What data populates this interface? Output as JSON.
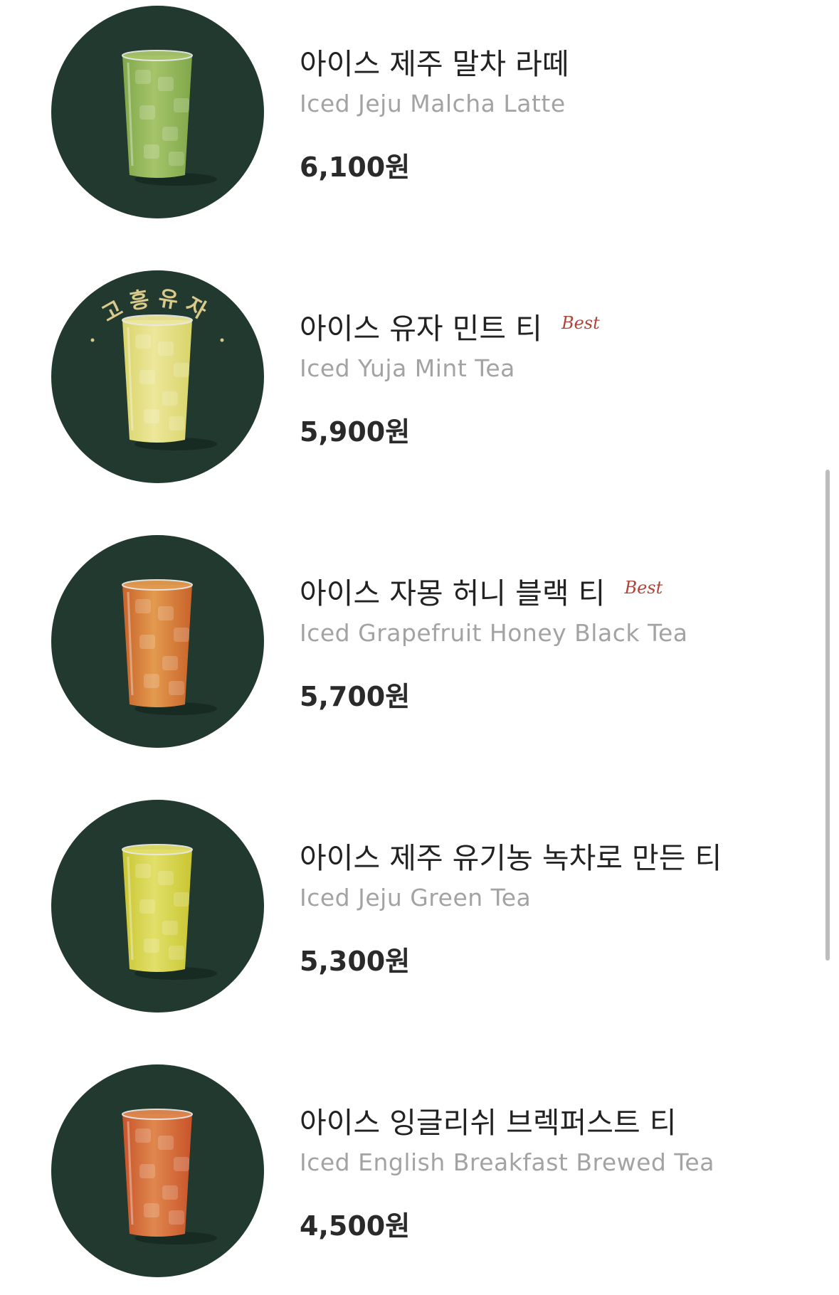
{
  "items": [
    {
      "name_ko": "아이스 제주 말차 라떼",
      "name_en": "Iced Jeju Malcha Latte",
      "price": "6,100원",
      "best": "",
      "drink_color": "#7fa84a",
      "drink_color_light": "#a6c46a",
      "ribbon_text": ""
    },
    {
      "name_ko": "아이스 유자 민트 티",
      "name_en": "Iced Yuja Mint Tea",
      "price": "5,900원",
      "best": "Best",
      "drink_color": "#d9d46a",
      "drink_color_light": "#ece79a",
      "ribbon_text": "고흥유자"
    },
    {
      "name_ko": "아이스 자몽 허니 블랙 티",
      "name_en": "Iced Grapefruit Honey Black Tea",
      "price": "5,700원",
      "best": "Best",
      "drink_color": "#c8632a",
      "drink_color_light": "#e39a4e",
      "ribbon_text": ""
    },
    {
      "name_ko": "아이스 제주 유기농 녹차로 만든 티",
      "name_en": "Iced Jeju Green Tea",
      "price": "5,300원",
      "best": "",
      "drink_color": "#c9c632",
      "drink_color_light": "#e2df6a",
      "ribbon_text": ""
    },
    {
      "name_ko": "아이스 잉글리쉬 브렉퍼스트 티",
      "name_en": "Iced English Breakfast Brewed Tea",
      "price": "4,500원",
      "best": "",
      "drink_color": "#c8542a",
      "drink_color_light": "#e0874e",
      "ribbon_text": ""
    }
  ],
  "colors": {
    "thumb_bg": "#22392f",
    "best": "#b0453a",
    "ribbon_text": "#d9c98a"
  }
}
